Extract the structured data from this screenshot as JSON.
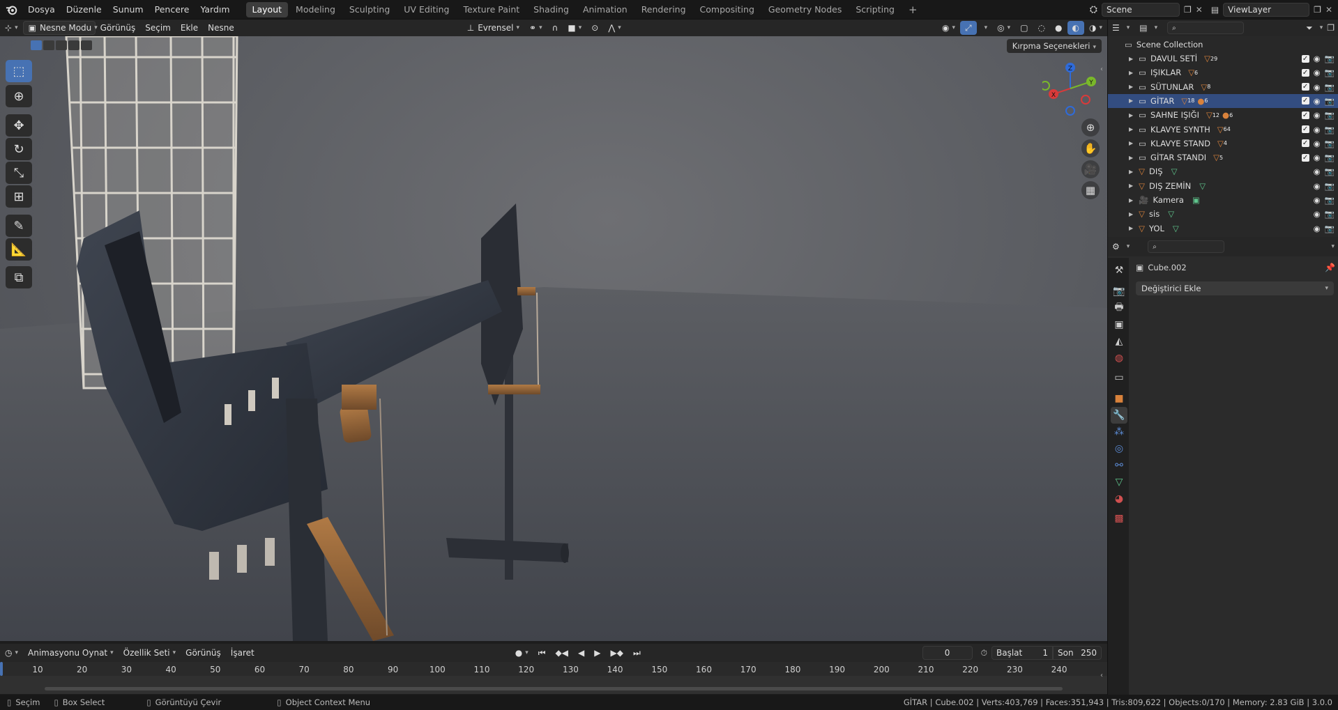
{
  "topbar": {
    "menus": [
      "Dosya",
      "Düzenle",
      "Sunum",
      "Pencere",
      "Yardım"
    ],
    "workspaces": [
      "Layout",
      "Modeling",
      "Sculpting",
      "UV Editing",
      "Texture Paint",
      "Shading",
      "Animation",
      "Rendering",
      "Compositing",
      "Geometry Nodes",
      "Scripting"
    ],
    "active_workspace": "Layout",
    "add_tab": "+",
    "scene": "Scene",
    "view_layer": "ViewLayer"
  },
  "viewport_header": {
    "mode": "Nesne Modu",
    "menus": [
      "Görünüş",
      "Seçim",
      "Ekle",
      "Nesne"
    ],
    "orientation": "Evrensel",
    "clip_options": "Kırpma Seçenekleri"
  },
  "gizmo": {
    "z": "Z",
    "y": "Y",
    "x": "X"
  },
  "outliner": {
    "root": "Scene Collection",
    "items": [
      {
        "name": "DAVUL SETİ",
        "count": "29"
      },
      {
        "name": "IŞIKLAR",
        "count": "6"
      },
      {
        "name": "SÜTUNLAR",
        "count": "8"
      },
      {
        "name": "GİTAR",
        "count": "18",
        "count2": "6"
      },
      {
        "name": "SAHNE IŞIĞI",
        "count": "12",
        "count2": "6"
      },
      {
        "name": "KLAVYE SYNTH",
        "count": "64"
      },
      {
        "name": "KLAVYE STAND",
        "count": "4"
      },
      {
        "name": "GİTAR STANDI",
        "count": "5"
      },
      {
        "name": "DIŞ",
        "count": ""
      },
      {
        "name": "DIŞ ZEMİN",
        "count": ""
      },
      {
        "name": "Kamera",
        "count": ""
      },
      {
        "name": "sis",
        "count": ""
      },
      {
        "name": "YOL",
        "count": ""
      }
    ],
    "selected": "GİTAR"
  },
  "properties": {
    "object_name": "Cube.002",
    "add_modifier": "Değiştirici Ekle"
  },
  "timeline": {
    "menus": [
      "Animasyonu Oynat",
      "Özellik Seti",
      "Görünüş",
      "İşaret"
    ],
    "current_frame": "0",
    "start_label": "Başlat",
    "start_value": "1",
    "end_label": "Son",
    "end_value": "250",
    "ticks": [
      "10",
      "20",
      "30",
      "40",
      "50",
      "60",
      "70",
      "80",
      "90",
      "100",
      "110",
      "120",
      "130",
      "140",
      "150",
      "160",
      "170",
      "180",
      "190",
      "200",
      "210",
      "220",
      "230",
      "240"
    ]
  },
  "status": {
    "select": "Seçim",
    "box_select": "Box Select",
    "rotate_view": "Görüntüyü Çevir",
    "context_menu": "Object Context Menu",
    "stats": "GİTAR | Cube.002 | Verts:403,769 | Faces:351,943 | Tris:809,622 | Objects:0/170 | Memory: 2.83 GiB | 3.0.0"
  },
  "colors": {
    "accent": "#4772b3",
    "selection": "#334d80",
    "orange": "#d9823b",
    "green": "#5fc58c"
  }
}
